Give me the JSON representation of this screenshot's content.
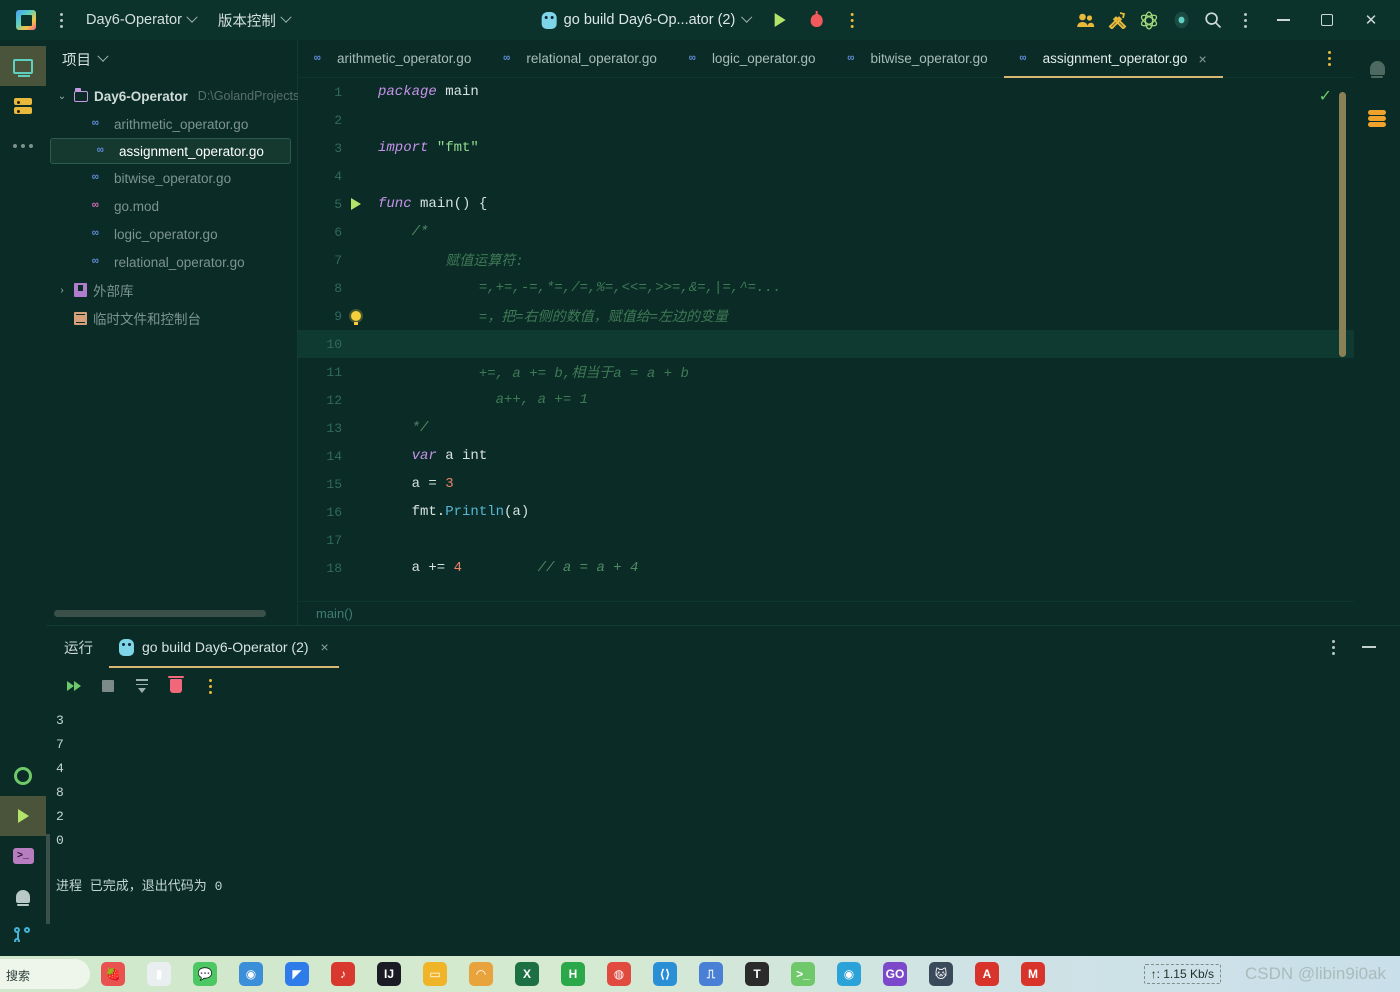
{
  "titlebar": {
    "logo": "goland-logo",
    "menu_dots": "main-menu",
    "project_name": "Day6-Operator",
    "vcs_label": "版本控制",
    "run_config": "go build Day6-Op...ator (2)",
    "icons": [
      "run-icon",
      "debug-icon",
      "more-actions-icon",
      "collaborate-icon",
      "build-tools-icon",
      "ai-assistant-icon",
      "updates-icon",
      "search-icon",
      "more-icon"
    ],
    "window_controls": [
      "minimize",
      "maximize",
      "close"
    ]
  },
  "left_rail": {
    "top": [
      {
        "name": "project-tool-window",
        "icon": "monitor-icon",
        "active": true
      },
      {
        "name": "database-tool-window",
        "icon": "database-icon",
        "active": false
      },
      {
        "name": "more-tool-windows",
        "icon": "ellipsis-icon",
        "active": false
      }
    ],
    "bottom": [
      {
        "name": "settings",
        "icon": "gear-icon",
        "active": false
      },
      {
        "name": "run-tool-window",
        "icon": "run-icon",
        "active": true
      },
      {
        "name": "terminal-tool-window",
        "icon": "terminal-icon",
        "active": false
      },
      {
        "name": "problems-tool-window",
        "icon": "bell-icon",
        "active": false
      },
      {
        "name": "version-control-tool-window",
        "icon": "git-branch-icon",
        "active": false
      }
    ]
  },
  "right_rail": [
    {
      "name": "notifications",
      "icon": "bell-icon"
    },
    {
      "name": "database",
      "icon": "database-icon"
    }
  ],
  "project_panel": {
    "title": "项目",
    "tree": [
      {
        "depth": 0,
        "arrow": "⌄",
        "icon": "folder-icon",
        "label": "Day6-Operator",
        "path": "D:\\GolandProjects",
        "bold": true,
        "selected": false
      },
      {
        "depth": 1,
        "arrow": "",
        "icon": "go-file-icon",
        "label": "arithmetic_operator.go",
        "path": "",
        "bold": false,
        "selected": false
      },
      {
        "depth": 1,
        "arrow": "",
        "icon": "go-file-icon",
        "label": "assignment_operator.go",
        "path": "",
        "bold": false,
        "selected": true
      },
      {
        "depth": 1,
        "arrow": "",
        "icon": "go-file-icon",
        "label": "bitwise_operator.go",
        "path": "",
        "bold": false,
        "selected": false
      },
      {
        "depth": 1,
        "arrow": "",
        "icon": "go-mod-icon",
        "label": "go.mod",
        "path": "",
        "bold": false,
        "selected": false
      },
      {
        "depth": 1,
        "arrow": "",
        "icon": "go-file-icon",
        "label": "logic_operator.go",
        "path": "",
        "bold": false,
        "selected": false
      },
      {
        "depth": 1,
        "arrow": "",
        "icon": "go-file-icon",
        "label": "relational_operator.go",
        "path": "",
        "bold": false,
        "selected": false
      },
      {
        "depth": 0,
        "arrow": "›",
        "icon": "library-icon",
        "label": "外部库",
        "path": "",
        "bold": false,
        "selected": false
      },
      {
        "depth": 0,
        "arrow": "",
        "icon": "scratch-icon",
        "label": "临时文件和控制台",
        "path": "",
        "bold": false,
        "selected": false
      }
    ]
  },
  "editor": {
    "tabs": [
      {
        "label": "arithmetic_operator.go",
        "active": false,
        "closable": false
      },
      {
        "label": "relational_operator.go",
        "active": false,
        "closable": false
      },
      {
        "label": "logic_operator.go",
        "active": false,
        "closable": false
      },
      {
        "label": "bitwise_operator.go",
        "active": false,
        "closable": false
      },
      {
        "label": "assignment_operator.go",
        "active": true,
        "closable": true
      }
    ],
    "close_label": "×",
    "breadcrumb": "main()",
    "inspection_status": "✓",
    "lines": [
      {
        "n": "1",
        "marker": "",
        "tokens": [
          {
            "t": "package ",
            "c": "kw"
          },
          {
            "t": "main",
            "c": "plain"
          }
        ]
      },
      {
        "n": "2",
        "marker": "",
        "tokens": []
      },
      {
        "n": "3",
        "marker": "",
        "tokens": [
          {
            "t": "import ",
            "c": "kw"
          },
          {
            "t": "\"fmt\"",
            "c": "str"
          }
        ]
      },
      {
        "n": "4",
        "marker": "",
        "tokens": []
      },
      {
        "n": "5",
        "marker": "run",
        "tokens": [
          {
            "t": "func ",
            "c": "kw"
          },
          {
            "t": "main() {",
            "c": "plain"
          }
        ]
      },
      {
        "n": "6",
        "marker": "",
        "tokens": [
          {
            "t": "    /*",
            "c": "cmt"
          }
        ]
      },
      {
        "n": "7",
        "marker": "",
        "tokens": [
          {
            "t": "        赋值运算符:",
            "c": "cmt2"
          }
        ]
      },
      {
        "n": "8",
        "marker": "",
        "tokens": [
          {
            "t": "            =,+=,-=,*=,/=,%=,<<=,>>=,&=,|=,^=...",
            "c": "cmt2"
          }
        ]
      },
      {
        "n": "9",
        "marker": "bulb",
        "tokens": [
          {
            "t": "            =，把=右侧的数值，赋值给=左边的变量",
            "c": "cmt2"
          }
        ]
      },
      {
        "n": "10",
        "marker": "",
        "tokens": [],
        "highlight": true
      },
      {
        "n": "11",
        "marker": "",
        "tokens": [
          {
            "t": "            +=, a += b,相当于a = a + b",
            "c": "cmt2"
          }
        ]
      },
      {
        "n": "12",
        "marker": "",
        "tokens": [
          {
            "t": "              a++, a += 1",
            "c": "cmt2"
          }
        ]
      },
      {
        "n": "13",
        "marker": "",
        "tokens": [
          {
            "t": "    */",
            "c": "cmt"
          }
        ]
      },
      {
        "n": "14",
        "marker": "",
        "tokens": [
          {
            "t": "    var ",
            "c": "kw"
          },
          {
            "t": "a int",
            "c": "plain"
          }
        ]
      },
      {
        "n": "15",
        "marker": "",
        "tokens": [
          {
            "t": "    a = ",
            "c": "plain"
          },
          {
            "t": "3",
            "c": "num"
          }
        ]
      },
      {
        "n": "16",
        "marker": "",
        "tokens": [
          {
            "t": "    fmt.",
            "c": "plain"
          },
          {
            "t": "Println",
            "c": "fn"
          },
          {
            "t": "(a)",
            "c": "plain"
          }
        ]
      },
      {
        "n": "17",
        "marker": "",
        "tokens": []
      },
      {
        "n": "18",
        "marker": "",
        "tokens": [
          {
            "t": "    a += ",
            "c": "plain"
          },
          {
            "t": "4",
            "c": "num"
          },
          {
            "t": "         // a = a + 4",
            "c": "cmt"
          }
        ]
      }
    ]
  },
  "run_panel": {
    "title": "运行",
    "tab_label": "go build Day6-Operator (2)",
    "tab_close": "×",
    "toolbar": [
      "rerun-icon",
      "stop-icon",
      "scroll-to-end-icon",
      "clear-all-icon",
      "more-icon"
    ],
    "collapse_icon": "minimize-icon",
    "output": [
      "3",
      "7",
      "4",
      "8",
      "2",
      "0"
    ],
    "exit_message": "进程 已完成，退出代码为 0"
  },
  "taskbar": {
    "search_label": "搜索",
    "network_speed": "↑: 1.15 Kb/s",
    "watermark": "CSDN @libin9i0ak",
    "apps": [
      {
        "name": "app-fruit",
        "glyph": "🍓",
        "color": "#e8534f"
      },
      {
        "name": "app-explorer",
        "glyph": "▮",
        "color": "#e9eef0"
      },
      {
        "name": "app-wechat",
        "glyph": "💬",
        "color": "#4cc764"
      },
      {
        "name": "app-browser",
        "glyph": "◉",
        "color": "#3b8fd8"
      },
      {
        "name": "app-dingtalk",
        "glyph": "◤",
        "color": "#2e7bea"
      },
      {
        "name": "app-netease",
        "glyph": "♪",
        "color": "#d8382e"
      },
      {
        "name": "app-idea",
        "glyph": "IJ",
        "color": "#1b1b25"
      },
      {
        "name": "app-folder",
        "glyph": "▭",
        "color": "#f0b429"
      },
      {
        "name": "app-sogou",
        "glyph": "◠",
        "color": "#e8a33d"
      },
      {
        "name": "app-excel",
        "glyph": "X",
        "color": "#1d7044"
      },
      {
        "name": "app-huawei",
        "glyph": "H",
        "color": "#2aa84a"
      },
      {
        "name": "app-chrome",
        "glyph": "◍",
        "color": "#e04a3f"
      },
      {
        "name": "app-vscode",
        "glyph": "⟨⟩",
        "color": "#2b8fd6"
      },
      {
        "name": "app-monitor",
        "glyph": "⎍",
        "color": "#4a7fd6"
      },
      {
        "name": "app-typora",
        "glyph": "T",
        "color": "#2b2b2b"
      },
      {
        "name": "app-console",
        "glyph": ">_",
        "color": "#6fc96a"
      },
      {
        "name": "app-edge",
        "glyph": "◉",
        "color": "#2ba3d8"
      },
      {
        "name": "app-goland",
        "glyph": "GO",
        "color": "#7b49c9"
      },
      {
        "name": "app-cat",
        "glyph": "🐱",
        "color": "#3a4a5a"
      },
      {
        "name": "app-acrobat",
        "glyph": "A",
        "color": "#d8342b"
      },
      {
        "name": "app-mail",
        "glyph": "M",
        "color": "#d8342b"
      }
    ]
  },
  "colors": {
    "bg": "#0b2b26",
    "titlebar": "#0c322c",
    "accent": "#d8b775",
    "selection": "#15392f",
    "keyword": "#c792ea",
    "string": "#8fd98f",
    "comment": "#4f8a62",
    "number": "#e8836a",
    "function": "#56b6d6"
  }
}
